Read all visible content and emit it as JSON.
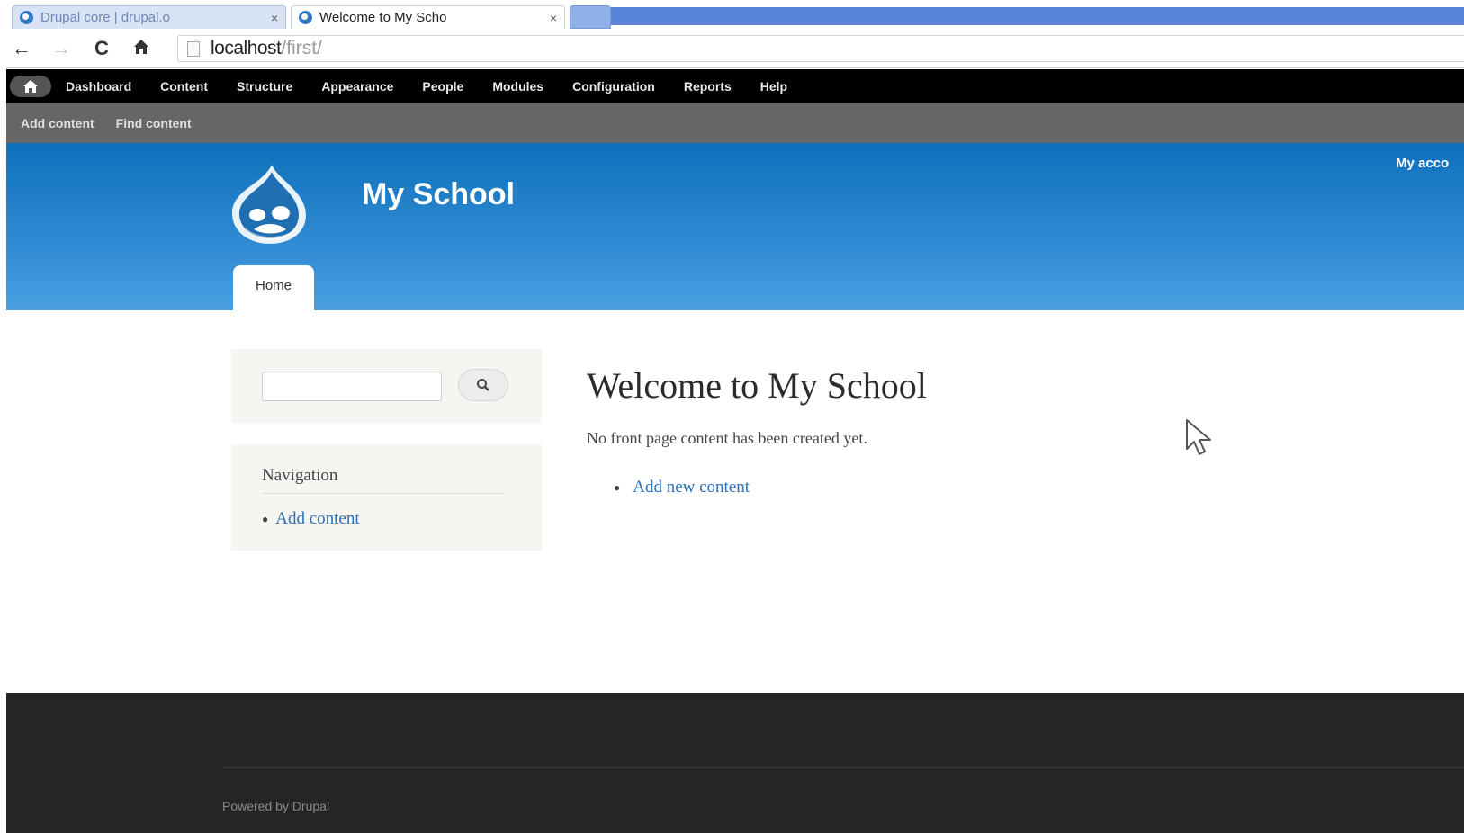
{
  "browser": {
    "tabs": [
      {
        "title": "Drupal core | drupal.o",
        "close": "×",
        "active": false
      },
      {
        "title": "Welcome to My Scho",
        "close": "×",
        "active": true
      }
    ],
    "address": {
      "host": "localhost",
      "path": "/first/"
    },
    "nav_icons": {
      "back": "back-arrow-icon",
      "forward": "forward-arrow-icon",
      "reload": "reload-icon",
      "home": "home-icon"
    }
  },
  "toolbar": {
    "home_icon": "home-icon",
    "menu": [
      "Dashboard",
      "Content",
      "Structure",
      "Appearance",
      "People",
      "Modules",
      "Configuration",
      "Reports",
      "Help"
    ],
    "shortcuts": [
      "Add content",
      "Find content"
    ]
  },
  "header": {
    "site_name": "My School",
    "my_account": "My acco",
    "home_tab": "Home",
    "colors": {
      "gradient_top": "#0f70bb",
      "gradient_bottom": "#4aa0e3"
    }
  },
  "sidebar": {
    "search": {
      "placeholder": "",
      "button_icon": "magnifier-icon"
    },
    "navigation": {
      "title": "Navigation",
      "links": [
        "Add content"
      ]
    }
  },
  "main": {
    "title": "Welcome to My School",
    "text": "No front page content has been created yet.",
    "links": [
      "Add new content"
    ]
  },
  "footer": {
    "powered_by": "Powered by Drupal"
  }
}
